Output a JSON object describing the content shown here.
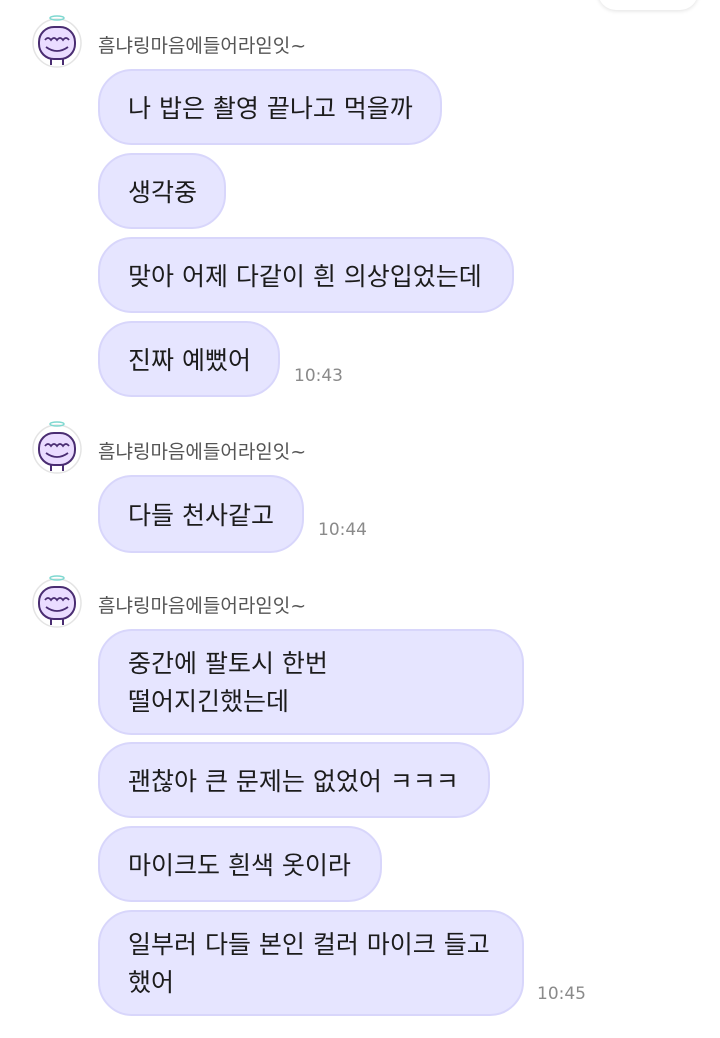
{
  "sender_name": "흠냐링마음에들어라읻잇~",
  "groups": [
    {
      "messages": [
        "나 밥은 촬영 끝나고 먹을까",
        "생각중",
        "맞아 어제 다같이 흰 의상입었는데",
        "진짜 예뻤어"
      ],
      "time": "10:43"
    },
    {
      "messages": [
        "다들 천사같고"
      ],
      "time": "10:44"
    },
    {
      "messages": [
        "중간에 팔토시 한번\n떨어지긴했는데",
        "괜찮아 큰 문제는 없었어 ㅋㅋㅋ",
        "마이크도 흰색 옷이라",
        "일부러 다들 본인 컬러 마이크 들고\n했어"
      ],
      "time": "10:45"
    }
  ]
}
